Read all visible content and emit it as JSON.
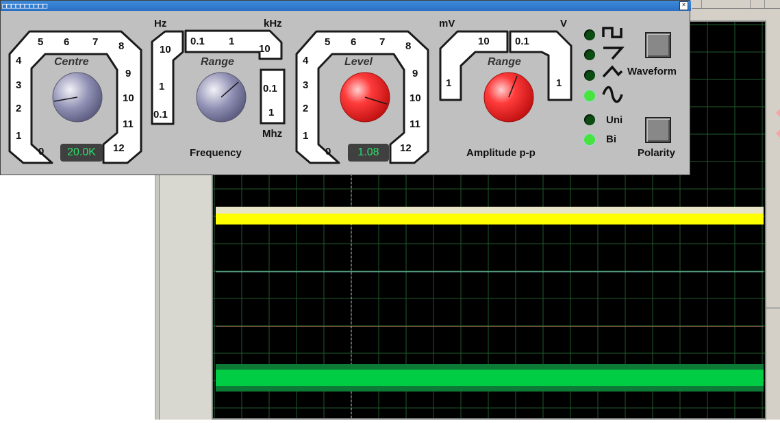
{
  "window": {
    "title": "□□□□□□□□□□",
    "close_glyph": "×"
  },
  "centre_dial": {
    "title": "Centre",
    "scale": [
      "0",
      "1",
      "2",
      "3",
      "4",
      "5",
      "6",
      "7",
      "8",
      "9",
      "10",
      "11",
      "12"
    ],
    "readout": "20.0K"
  },
  "frequency_range": {
    "title": "Range",
    "units": [
      "Hz",
      "kHz",
      "Mhz"
    ],
    "scale": [
      "0.1",
      "1",
      "10",
      "0.1",
      "1",
      "10",
      "0.1",
      "1"
    ],
    "label": "Frequency"
  },
  "level_dial": {
    "title": "Level",
    "scale": [
      "0",
      "1",
      "2",
      "3",
      "4",
      "5",
      "6",
      "7",
      "8",
      "9",
      "10",
      "11",
      "12"
    ],
    "readout": "1.08"
  },
  "amplitude_range": {
    "title": "Range",
    "units": [
      "mV",
      "V"
    ],
    "scale": [
      "1",
      "10",
      "0.1",
      "1"
    ],
    "label": "Amplitude p-p"
  },
  "waveform": {
    "options": [
      {
        "icon": "square-wave-icon",
        "active": false
      },
      {
        "icon": "sawtooth-wave-icon",
        "active": false
      },
      {
        "icon": "triangle-wave-icon",
        "active": false
      },
      {
        "icon": "sine-wave-icon",
        "active": true
      }
    ],
    "button_label": "Waveform"
  },
  "polarity": {
    "options": [
      {
        "label": "Uni",
        "active": false
      },
      {
        "label": "Bi",
        "active": true
      }
    ],
    "button_label": "Polarity"
  },
  "colors": {
    "title_bar": "#2a6fc4",
    "panel": "#c0c0c0",
    "led_on": "#49e33f",
    "led_off": "#0d4c12",
    "lcd_text": "#2ee06a",
    "trace_a": "#ffff00",
    "trace_d": "#00cc44",
    "scope_grid": "#1f5a2c"
  }
}
